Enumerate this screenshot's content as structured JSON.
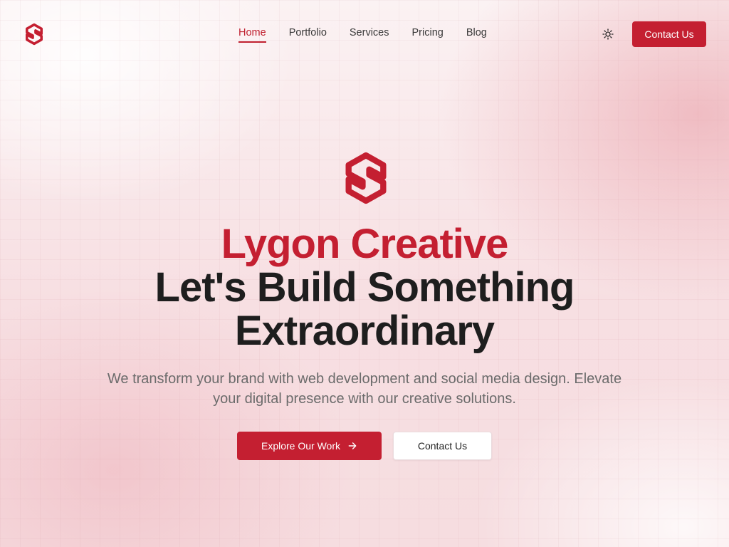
{
  "colors": {
    "accent": "#c41f31",
    "text": "#1e1e1e",
    "muted": "#6b6b6b"
  },
  "nav": {
    "logo_icon": "lygon-logo-icon",
    "links": [
      {
        "label": "Home",
        "active": true
      },
      {
        "label": "Portfolio",
        "active": false
      },
      {
        "label": "Services",
        "active": false
      },
      {
        "label": "Pricing",
        "active": false
      },
      {
        "label": "Blog",
        "active": false
      }
    ],
    "theme_icon": "sun-icon",
    "cta_label": "Contact Us"
  },
  "hero": {
    "logo_icon": "lygon-logo-icon",
    "brand": "Lygon Creative",
    "headline": "Let's Build Something Extraordinary",
    "subtitle": "We transform your brand with web development and social media design. Elevate your digital presence with our creative solutions.",
    "primary_button": "Explore Our Work",
    "primary_button_icon": "arrow-right-icon",
    "secondary_button": "Contact Us"
  }
}
